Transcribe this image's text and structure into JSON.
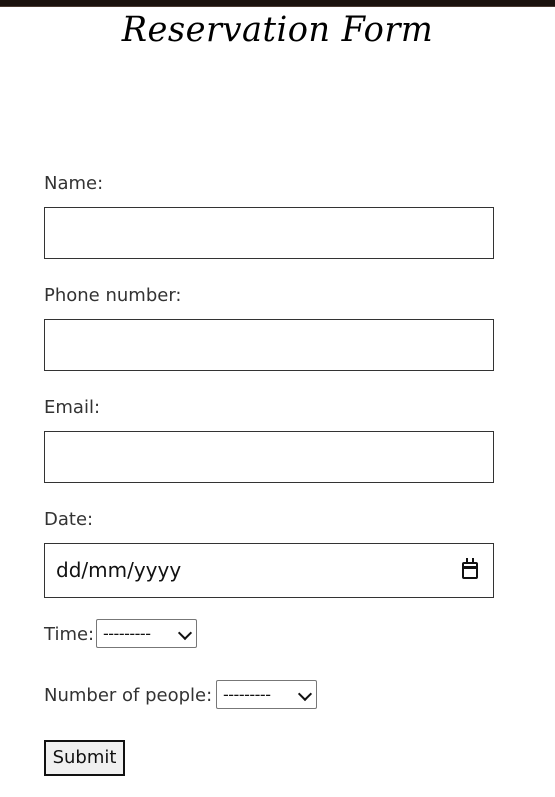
{
  "page": {
    "title": "Reservation Form",
    "colors": {
      "text": "#333333",
      "title": "#000000",
      "border": "#333333",
      "top_bar": "#1b120d",
      "button_bg": "#f0f0f0"
    }
  },
  "form": {
    "name": {
      "label": "Name:",
      "value": "",
      "placeholder": ""
    },
    "phone": {
      "label": "Phone number:",
      "value": "",
      "placeholder": ""
    },
    "email": {
      "label": "Email:",
      "value": "",
      "placeholder": ""
    },
    "date": {
      "label": "Date:",
      "value": "dd/mm/yyyy",
      "icon": "calendar-icon"
    },
    "time": {
      "label": "Time:",
      "selected": "---------",
      "icon": "chevron-down-icon"
    },
    "people": {
      "label": "Number of people:",
      "selected": "---------",
      "icon": "chevron-down-icon"
    },
    "submit_label": "Submit"
  }
}
